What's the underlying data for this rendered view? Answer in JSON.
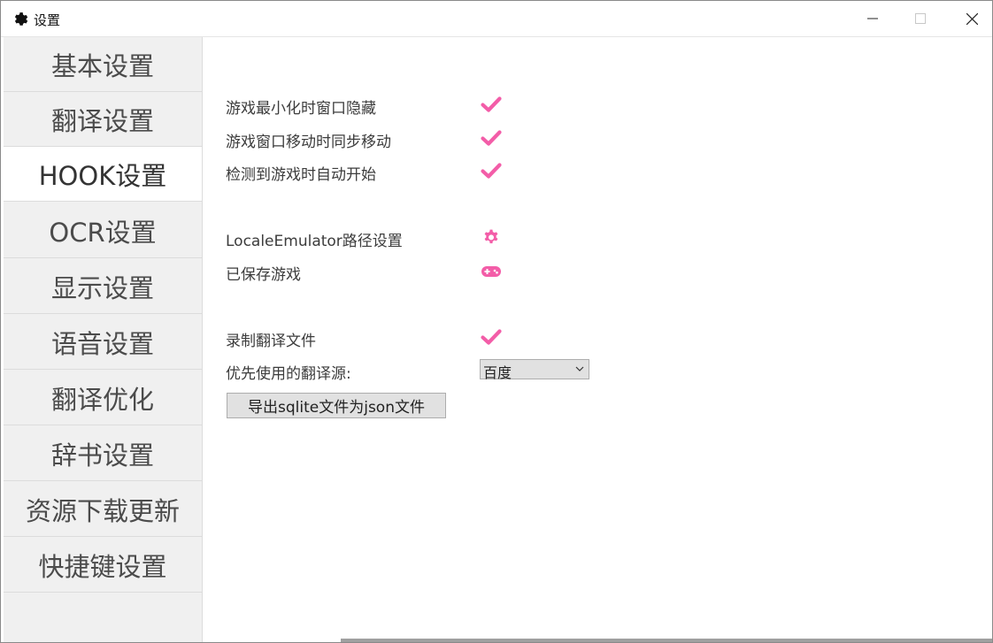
{
  "window": {
    "title": "设置",
    "accent_color": "#f35da8",
    "controls": {
      "minimize": "minimize-icon",
      "maximize": "maximize-icon",
      "close": "close-icon"
    }
  },
  "sidebar": {
    "items": [
      {
        "label": "基本设置"
      },
      {
        "label": "翻译设置"
      },
      {
        "label": "HOOK设置",
        "active": true
      },
      {
        "label": "OCR设置"
      },
      {
        "label": "显示设置"
      },
      {
        "label": "语音设置"
      },
      {
        "label": "翻译优化"
      },
      {
        "label": "辞书设置"
      },
      {
        "label": "资源下载更新"
      },
      {
        "label": "快捷键设置"
      }
    ]
  },
  "settings": {
    "hide_on_minimize": {
      "label": "游戏最小化时窗口隐藏",
      "checked": true
    },
    "sync_move": {
      "label": "游戏窗口移动时同步移动",
      "checked": true
    },
    "auto_start": {
      "label": "检测到游戏时自动开始",
      "checked": true
    },
    "le_path": {
      "label": "LocaleEmulator路径设置",
      "icon": "gear-icon"
    },
    "saved_games": {
      "label": "已保存游戏",
      "icon": "gamepad-icon"
    },
    "record_translation": {
      "label": "录制翻译文件",
      "checked": true
    },
    "preferred_source": {
      "label": "优先使用的翻译源:",
      "value": "百度"
    },
    "export_button": {
      "label": "导出sqlite文件为json文件"
    }
  }
}
